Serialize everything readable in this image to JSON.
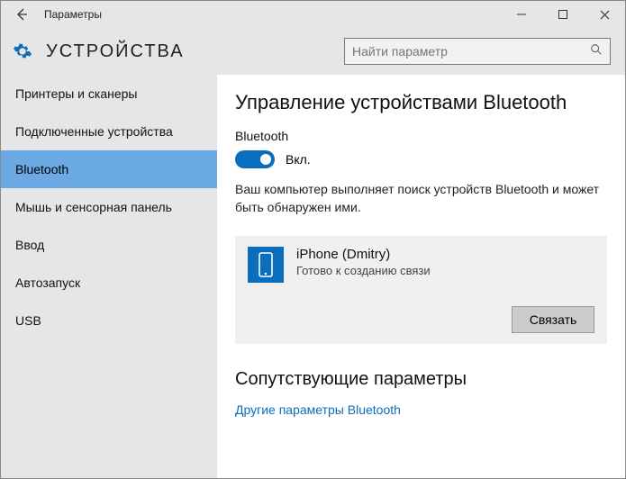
{
  "window": {
    "title": "Параметры",
    "category": "УСТРОЙСТВА",
    "search_placeholder": "Найти параметр"
  },
  "sidebar": {
    "items": [
      {
        "label": "Принтеры и сканеры"
      },
      {
        "label": "Подключенные устройства"
      },
      {
        "label": "Bluetooth",
        "active": true
      },
      {
        "label": "Мышь и сенсорная панель"
      },
      {
        "label": "Ввод"
      },
      {
        "label": "Автозапуск"
      },
      {
        "label": "USB"
      }
    ]
  },
  "main": {
    "title": "Управление устройствами Bluetooth",
    "toggle_section_label": "Bluetooth",
    "toggle_state_label": "Вкл.",
    "toggle_on": true,
    "description": "Ваш компьютер выполняет поиск устройств Bluetooth и может быть обнаружен ими.",
    "device": {
      "name": "iPhone (Dmitry)",
      "status": "Готово к созданию связи",
      "action": "Связать"
    },
    "related_heading": "Сопутствующие параметры",
    "related_link": "Другие параметры Bluetooth"
  },
  "colors": {
    "accent": "#0a6ebd"
  }
}
